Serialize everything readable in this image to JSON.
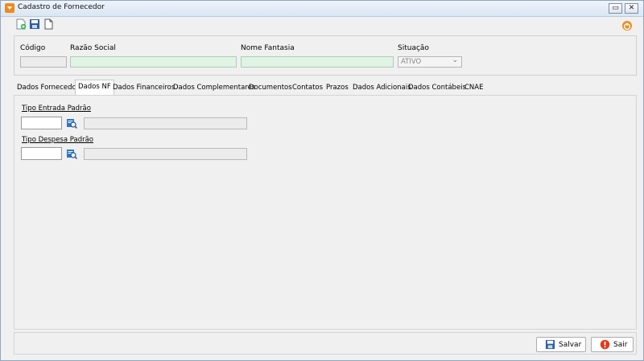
{
  "window": {
    "title": "Cadastro de Fornecedor",
    "controls": {
      "restore": "▭",
      "close": "✕"
    }
  },
  "toolbar": {
    "icons": [
      "new-document-icon",
      "save-icon",
      "copy-document-icon"
    ],
    "right_icon": "power-icon"
  },
  "header": {
    "codigo_label": "Código",
    "codigo_value": "",
    "razao_label": "Razão Social",
    "razao_value": "",
    "fantasia_label": "Nome Fantasia",
    "fantasia_value": "",
    "situacao_label": "Situação",
    "situacao_value": "ATIVO"
  },
  "tabs": [
    {
      "label": "Dados Fornecedor",
      "active": false
    },
    {
      "label": "Dados NF",
      "active": true
    },
    {
      "label": "Dados Financeiros",
      "active": false
    },
    {
      "label": "Dados Complementares",
      "active": false
    },
    {
      "label": "Documentos",
      "active": false
    },
    {
      "label": "Contatos",
      "active": false
    },
    {
      "label": "Prazos",
      "active": false
    },
    {
      "label": "Dados Adicionais",
      "active": false
    },
    {
      "label": "Dados Contábeis",
      "active": false
    },
    {
      "label": "CNAE",
      "active": false
    }
  ],
  "dados_nf": {
    "tipo_entrada_label": "Tipo Entrada Padrão",
    "tipo_entrada_code": "",
    "tipo_entrada_desc": "",
    "tipo_despesa_label": "Tipo Despesa Padrão",
    "tipo_despesa_code": "",
    "tipo_despesa_desc": ""
  },
  "footer": {
    "save_label": "Salvar",
    "exit_label": "Sair"
  },
  "colors": {
    "required_field": "#dff4e4",
    "accent_orange": "#f08a1c",
    "exit_red": "#e23a1e",
    "lookup_blue": "#2f77c4"
  }
}
